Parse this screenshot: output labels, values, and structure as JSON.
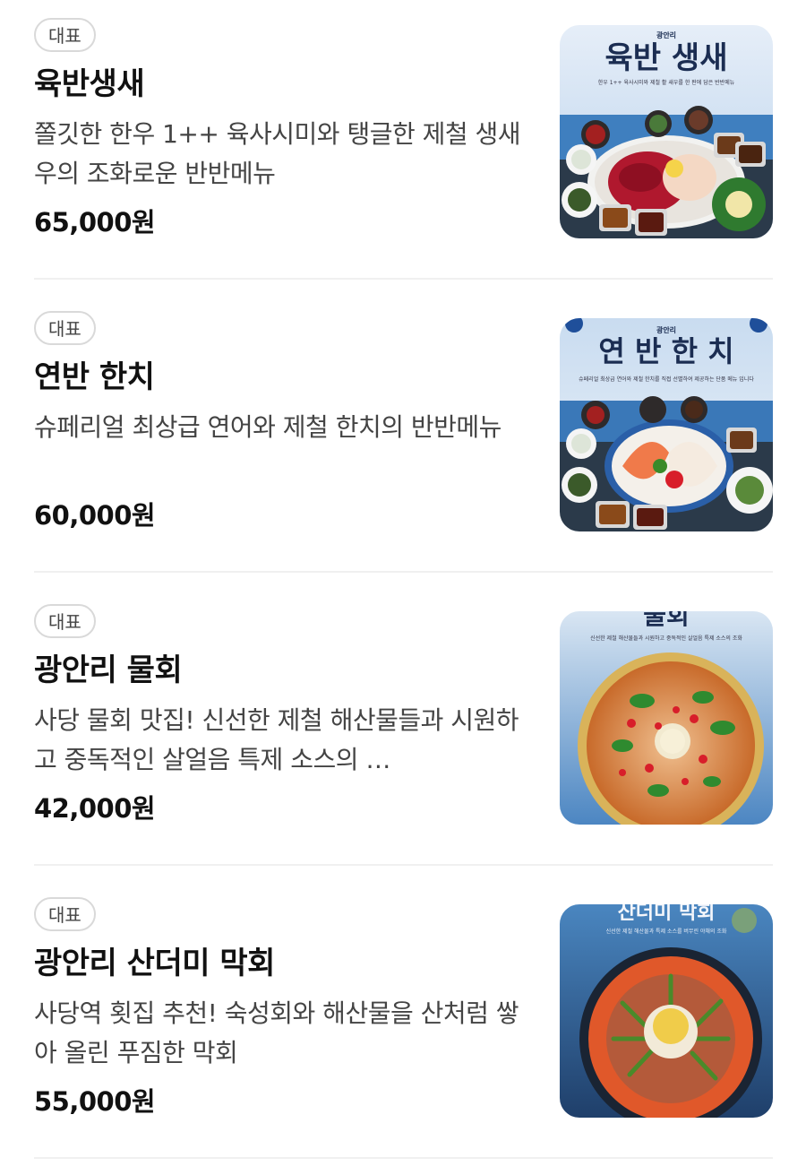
{
  "menu": {
    "items": [
      {
        "badge": "대표",
        "name": "육반생새",
        "description": "쫄깃한 한우 1++ 육사시미와 탱글한 제철 생새우의 조화로운 반반메뉴",
        "price": "65,000원",
        "image": {
          "brand": "광안리",
          "title": "육반 생새",
          "caption": "한우 1++ 육사시미와 제철 활 새우를 한 판에 담은 반반메뉴"
        }
      },
      {
        "badge": "대표",
        "name": "연반 한치",
        "description": "슈페리얼 최상급 연어와 제철 한치의 반반메뉴",
        "price": "60,000원",
        "image": {
          "brand": "광안리",
          "title": "연 반 한 치",
          "caption": "슈페리얼 최상급 연어와 제철 한치를 직접 선별하여 제공하는 단품 메뉴 입니다"
        }
      },
      {
        "badge": "대표",
        "name": "광안리 물회",
        "description": "사당 물회 맛집! 신선한 제철 해산물들과 시원하고 중독적인 살얼음 특제 소스의 …",
        "price": "42,000원",
        "image": {
          "brand": "",
          "title": "물회",
          "caption": "신선한 제철 해산물들과 시원하고 중독적인 살얼음 특제 소스의 조화"
        }
      },
      {
        "badge": "대표",
        "name": "광안리 산더미 막회",
        "description": "사당역 횟집 추천! 숙성회와 해산물을 산처럼 쌓아 올린 푸짐한 막회",
        "price": "55,000원",
        "image": {
          "brand": "",
          "title": "산더미 막회",
          "caption": "신선한 제철 해산물과 특제 소스를 버무린 야채의 조화"
        }
      }
    ]
  },
  "colors": {
    "sky": "#cfe0f2",
    "sea": "#3a78b8",
    "titleText": "#1b2d52",
    "salmon": "#f07a4a",
    "beef": "#b0182e",
    "broth": "#e08a3a",
    "roe": "#e0582a"
  },
  "icons": [
    "food-photo-image"
  ]
}
